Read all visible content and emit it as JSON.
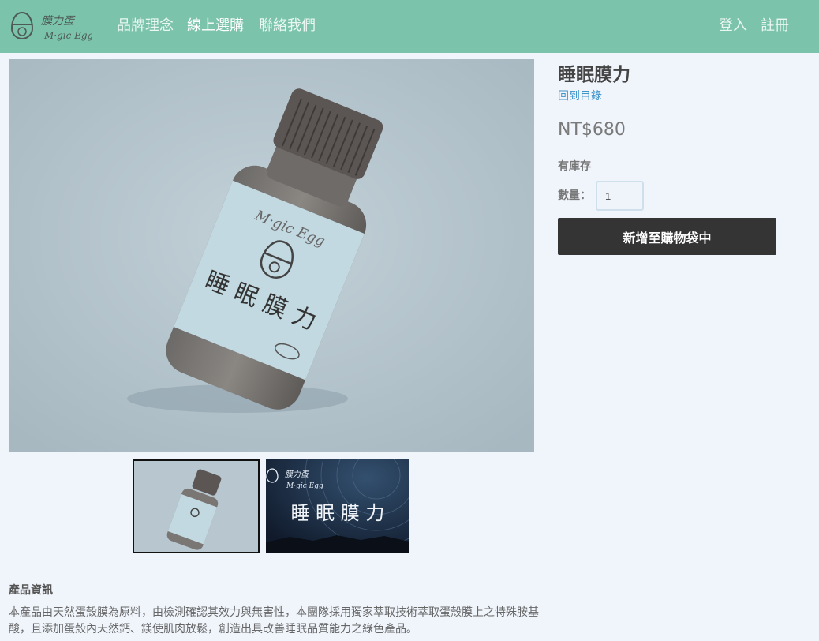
{
  "brand": {
    "name_cn": "膜力蛋",
    "name_en": "M·gic Egg",
    "logo_icon": "egg-flower-icon"
  },
  "nav": {
    "items": [
      {
        "label": "品牌理念"
      },
      {
        "label": "線上選購"
      },
      {
        "label": "聯絡我們"
      }
    ],
    "login": "登入",
    "register": "註冊"
  },
  "product": {
    "title": "睡眠膜力",
    "back_link": "回到目錄",
    "price": "NT$680",
    "stock": "有庫存",
    "quantity_label": "數量：",
    "quantity_value": "1",
    "add_button": "新增至購物袋中",
    "bottle_label_brand": "M·gic Egg",
    "bottle_label_name": "睡 眠 膜 力",
    "banner_brand_cn": "膜力蛋",
    "banner_brand_en": "M·gic Egg",
    "banner_title": "睡 眠 膜 力",
    "info_heading": "產品資訊",
    "info_text": "本產品由天然蛋殼膜為原料，由檢測確認其效力與無害性，本團隊採用獨家萃取技術萃取蛋殼膜上之特殊胺基酸，且添加蛋殼內天然鈣、鎂使肌肉放鬆，創造出具改善睡眠品質能力之綠色產品。"
  },
  "colors": {
    "navbar": "#7bc4ab",
    "page_bg": "#f0f5fc",
    "button": "#343434",
    "link": "#3f93c9"
  }
}
